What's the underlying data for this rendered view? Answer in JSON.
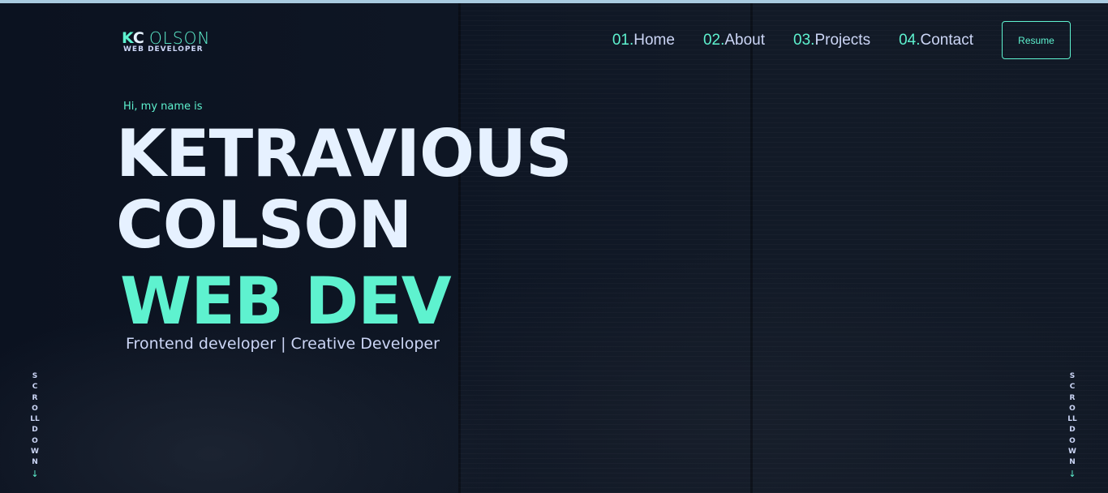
{
  "logo": {
    "mark": "K",
    "mark_c": "C",
    "name": "OLSON",
    "subtitle": "WEB DEVELOPER"
  },
  "nav": {
    "items": [
      {
        "num": "01.",
        "label": "Home"
      },
      {
        "num": "02.",
        "label": "About"
      },
      {
        "num": "03.",
        "label": "Projects"
      },
      {
        "num": "04.",
        "label": "Contact"
      }
    ],
    "resume_label": "Resume"
  },
  "hero": {
    "greeting": "Hi, my name is",
    "first_name": "KETRAVIOUS",
    "last_name": "COLSON",
    "role": "WEB DEV",
    "tagline": "Frontend developer | Creative Developer"
  },
  "scroll": {
    "label": "SCROLLDOWN",
    "arrow": "↓"
  },
  "colors": {
    "accent": "#5ef2cf",
    "background": "#0c1320",
    "text_light": "#e6f1ff",
    "text_muted": "#ccd6f6"
  }
}
